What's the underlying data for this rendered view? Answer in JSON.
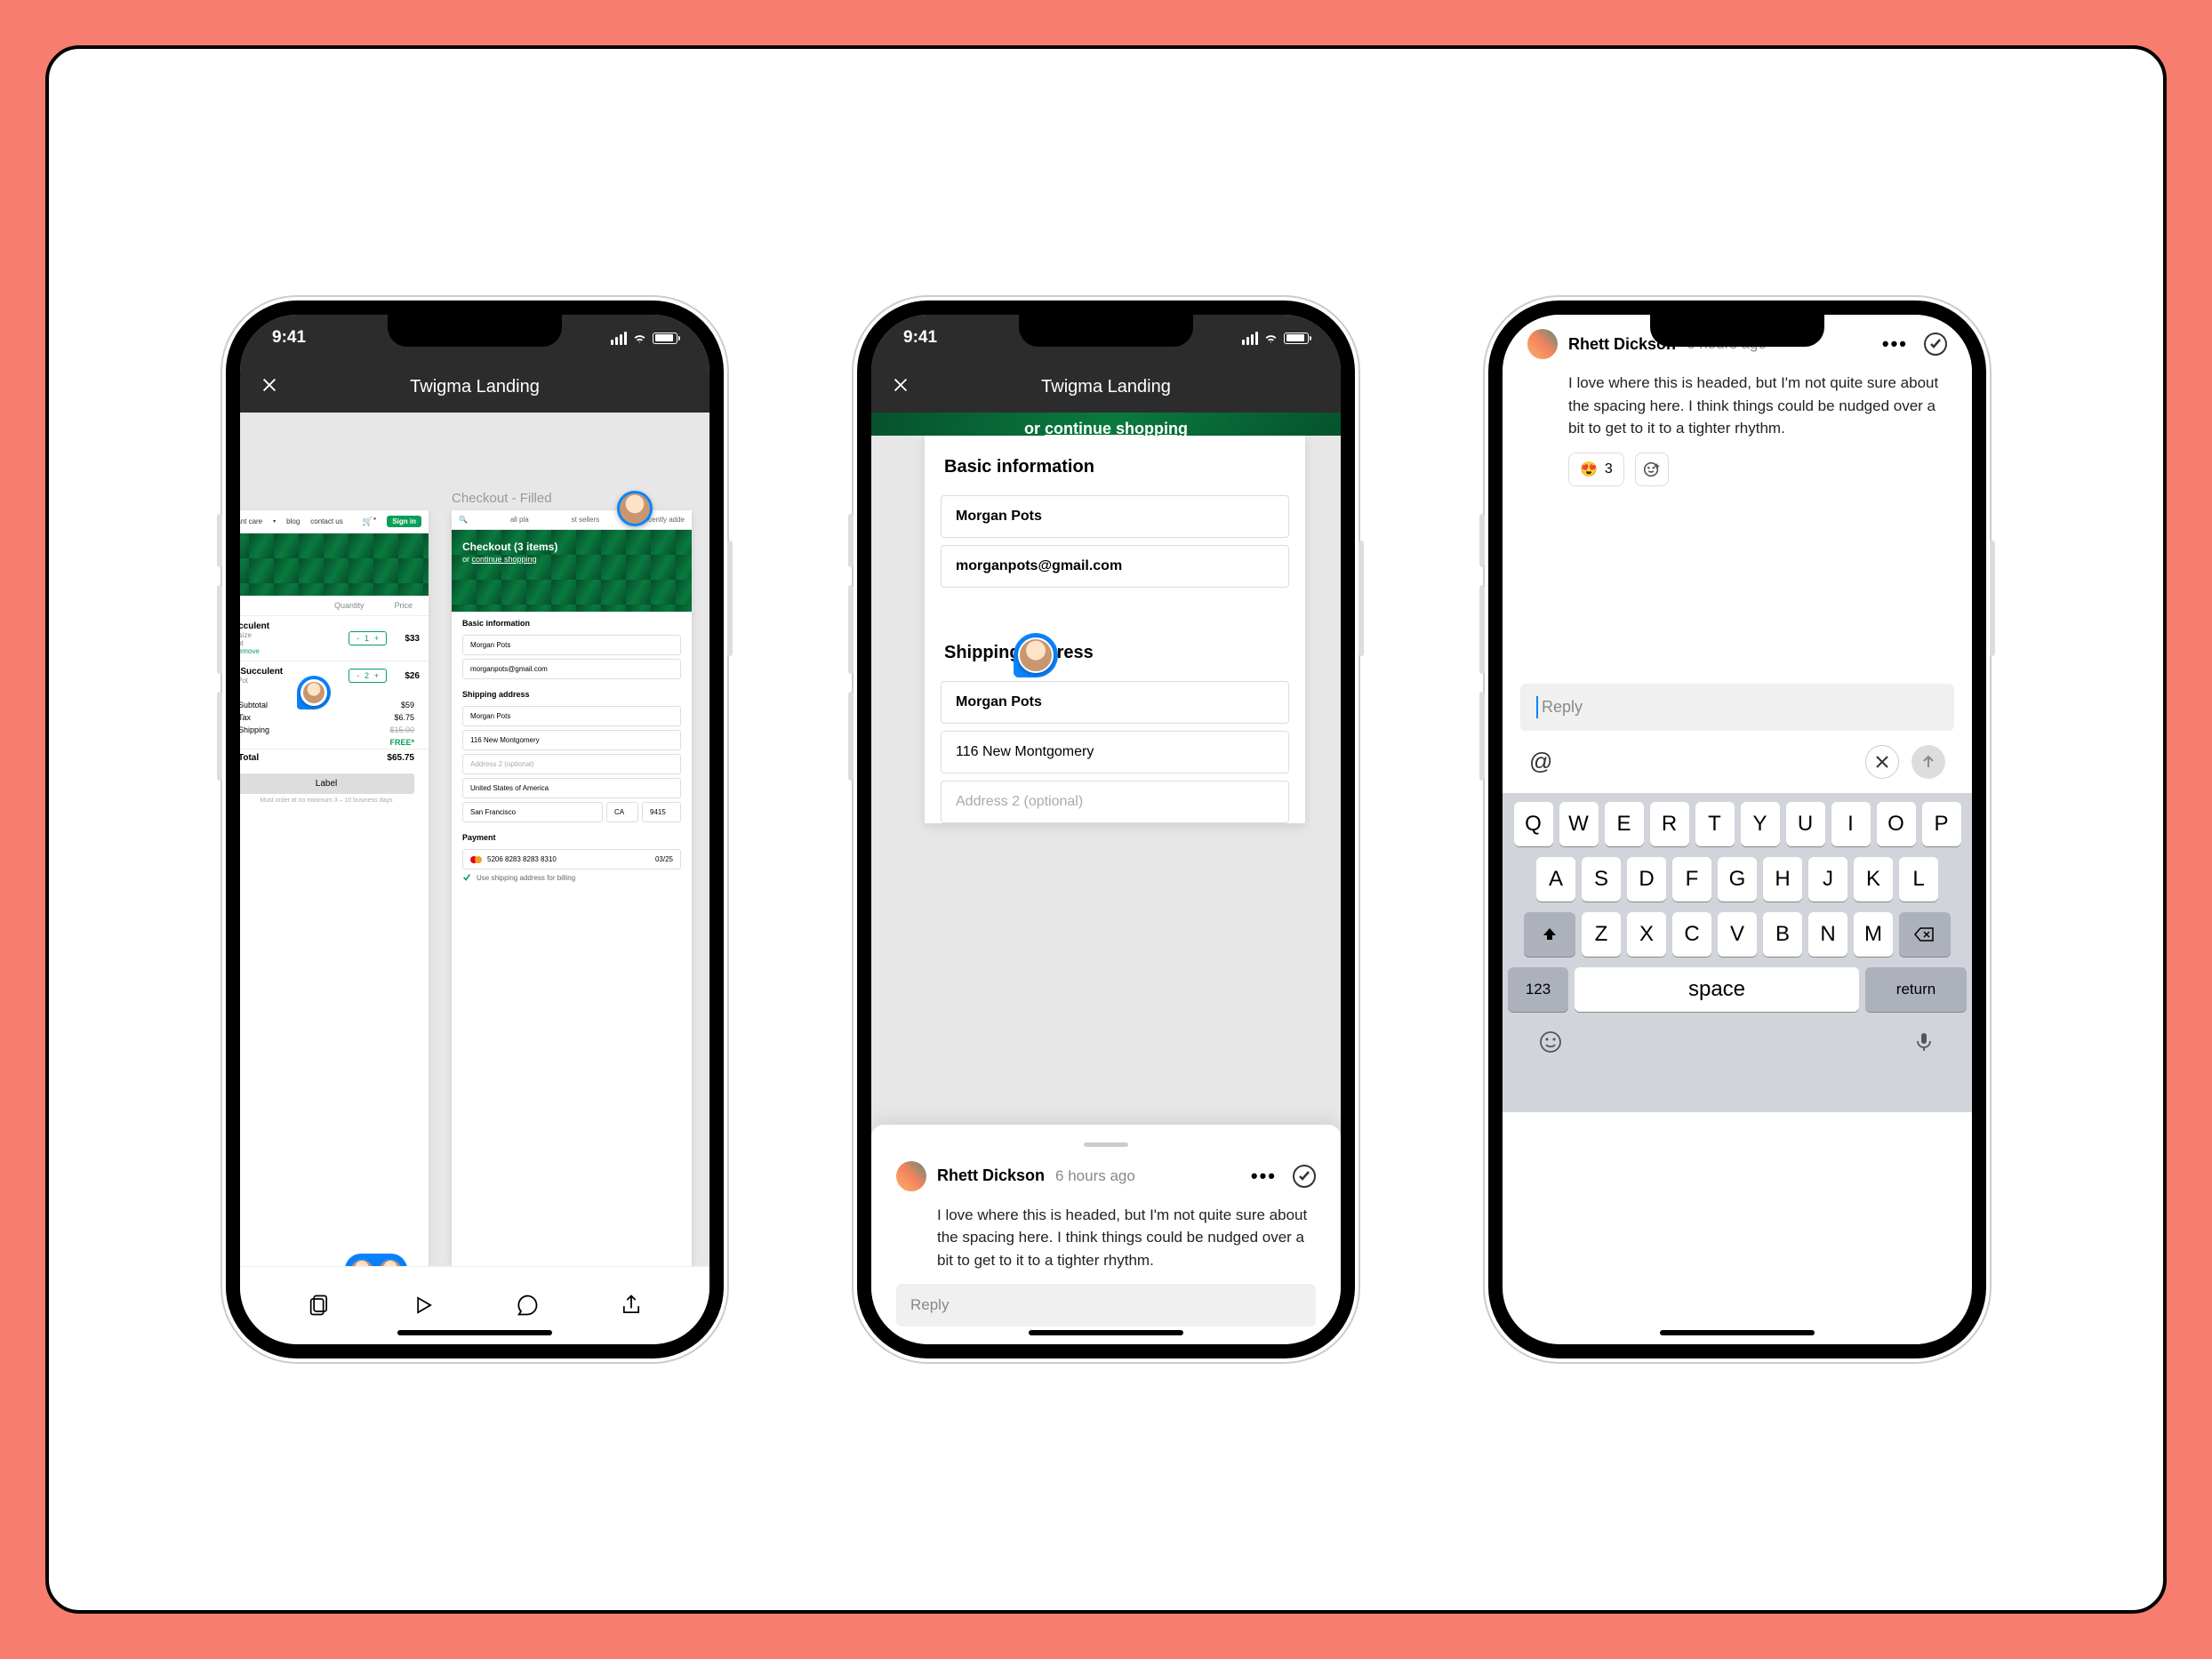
{
  "status_time": "9:41",
  "nav": {
    "title": "Twigma Landing"
  },
  "canvas": {
    "artboard_right_title": "Checkout - Filled",
    "left": {
      "nav_items": [
        "plant care",
        "blog",
        "contact us"
      ],
      "signin": "Sign in",
      "col_qty": "Quantity",
      "col_price": "Price",
      "item1": {
        "name": "ucculent",
        "sub1": "e size",
        "sub2": "Pot",
        "qty": "1",
        "price": "$33",
        "remove": "Remove"
      },
      "item2": {
        "name": "y Succulent",
        "sub1": "r Pot",
        "qty": "2",
        "price": "$26"
      },
      "sub_l": "Subtotal",
      "sub_v": "$59",
      "tax_l": "Tax",
      "tax_v": "$6.75",
      "ship_l": "Shipping",
      "ship_v": "FREE*",
      "ship_old": "$15.00",
      "tot_l": "Total",
      "tot_v": "$65.75",
      "label_btn": "Label",
      "fine": "Must order at no minimum 3 – 10 business days"
    },
    "right": {
      "nav_left": "all pla",
      "nav_mid": "st sellers",
      "nav_right": "recently adde",
      "title": "Checkout (3 items)",
      "sub_or": "or ",
      "sub_link": "continue shopping",
      "basic": "Basic information",
      "name": "Morgan Pots",
      "email": "morganpots@gmail.com",
      "ship": "Shipping address",
      "addr1": "Morgan Pots",
      "addr2": "116 New Montgomery",
      "addr3": "Address 2 (optional)",
      "country": "United States of America",
      "city": "San Francisco",
      "state": "CA",
      "zip": "9415",
      "payment": "Payment",
      "card": "5206 8283 8283 8310",
      "exp": "03/25",
      "billing": "Use shipping address for billing"
    }
  },
  "detail": {
    "banner_or": "or ",
    "banner_link": "continue shopping",
    "basic": "Basic information",
    "name": "Morgan Pots",
    "email": "morganpots@gmail.com",
    "ship": "Shipping address",
    "sname": "Morgan Pots",
    "saddr": "116 New Montgomery",
    "saddr2": "Address 2 (optional)"
  },
  "comment": {
    "author": "Rhett Dickson",
    "time": "6 hours ago",
    "body": "I love where this is headed, but I'm not quite sure about the spacing here. I think things could be nudged over a bit to get to it to a tighter rhythm.",
    "reply_ph": "Reply",
    "reaction_emoji": "😍",
    "reaction_count": "3"
  },
  "keyboard": {
    "r1": [
      "Q",
      "W",
      "E",
      "R",
      "T",
      "Y",
      "U",
      "I",
      "O",
      "P"
    ],
    "r2": [
      "A",
      "S",
      "D",
      "F",
      "G",
      "H",
      "J",
      "K",
      "L"
    ],
    "r3": [
      "Z",
      "X",
      "C",
      "V",
      "B",
      "N",
      "M"
    ],
    "num": "123",
    "space": "space",
    "ret": "return"
  },
  "mention": "@"
}
